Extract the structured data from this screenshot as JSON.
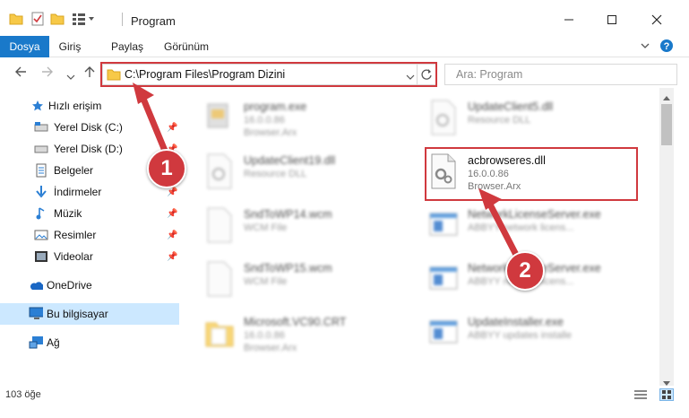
{
  "window": {
    "title": "Program",
    "minimize_icon": "minimize-icon",
    "maximize_icon": "maximize-icon",
    "close_icon": "close-icon"
  },
  "ribbon": {
    "tabs": [
      {
        "label": "Dosya",
        "active": true
      },
      {
        "label": "Giriş",
        "active": false
      },
      {
        "label": "Paylaş",
        "active": false
      },
      {
        "label": "Görünüm",
        "active": false
      }
    ]
  },
  "address": {
    "path": "C:\\Program Files\\Program Dizini"
  },
  "search": {
    "placeholder": "Ara: Program"
  },
  "navpane": {
    "items": [
      {
        "label": "Hızlı erişim",
        "icon": "star-icon",
        "pinned": false
      },
      {
        "label": "Yerel Disk (C:)",
        "icon": "drive-icon",
        "pinned": true
      },
      {
        "label": "Yerel Disk (D:)",
        "icon": "drive-icon",
        "pinned": true
      },
      {
        "label": "Belgeler",
        "icon": "documents-icon",
        "pinned": true
      },
      {
        "label": "İndirmeler",
        "icon": "download-icon",
        "pinned": true
      },
      {
        "label": "Müzik",
        "icon": "music-icon",
        "pinned": true
      },
      {
        "label": "Resimler",
        "icon": "pictures-icon",
        "pinned": true
      },
      {
        "label": "Videolar",
        "icon": "videos-icon",
        "pinned": true
      },
      {
        "label": "OneDrive",
        "icon": "cloud-icon",
        "pinned": false
      },
      {
        "label": "Bu bilgisayar",
        "icon": "computer-icon",
        "pinned": false,
        "selected": true
      },
      {
        "label": "Ağ",
        "icon": "network-icon",
        "pinned": false
      }
    ]
  },
  "files": [
    {
      "name": "program.exe",
      "meta1": "16.0.0.86",
      "meta2": "Browser.Arx",
      "icon": "exe-icon",
      "blurred": true
    },
    {
      "name": "UpdateClient5.dll",
      "meta1": "Resource DLL",
      "meta2": "",
      "icon": "dll-icon",
      "blurred": true
    },
    {
      "name": "UpdateClient19.dll",
      "meta1": "Resource DLL",
      "meta2": "",
      "icon": "dll-icon",
      "blurred": true
    },
    {
      "name": "acbrowseres.dll",
      "meta1": "16.0.0.86",
      "meta2": "Browser.Arx",
      "icon": "dll-gear-icon",
      "blurred": false
    },
    {
      "name": "SndToWP14.wcm",
      "meta1": "WCM File",
      "meta2": "",
      "icon": "file-icon",
      "blurred": true
    },
    {
      "name": "NetworkLicenseServer.exe",
      "meta1": "ABBYY network licens...",
      "meta2": "",
      "icon": "window-icon",
      "blurred": true
    },
    {
      "name": "SndToWP15.wcm",
      "meta1": "WCM File",
      "meta2": "",
      "icon": "file-icon",
      "blurred": true
    },
    {
      "name": "NetworkLicenseServer.exe",
      "meta1": "ABBYY network licens...",
      "meta2": "",
      "icon": "window-icon",
      "blurred": true
    },
    {
      "name": "Microsoft.VC90.CRT",
      "meta1": "16.0.0.86",
      "meta2": "Browser.Arx",
      "icon": "folder-icon",
      "blurred": true
    },
    {
      "name": "UpdateInstaller.exe",
      "meta1": "ABBYY updates installe",
      "meta2": "",
      "icon": "window-icon",
      "blurred": true
    }
  ],
  "status": {
    "count": "103 öğe"
  },
  "annotations": {
    "step1": "1",
    "step2": "2"
  },
  "colors": {
    "accent": "#1979ca",
    "highlight": "#d0393e",
    "selected": "#cce8ff"
  }
}
